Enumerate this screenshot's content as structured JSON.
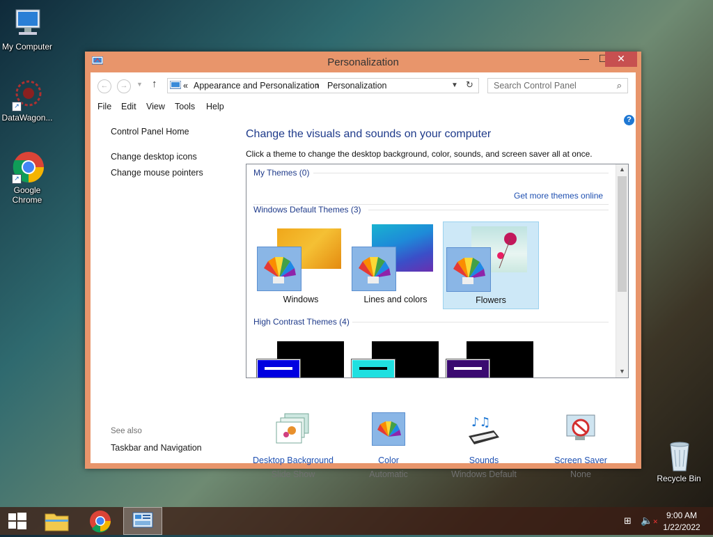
{
  "desktop": {
    "icons": [
      {
        "label": "My Computer"
      },
      {
        "label": "DataWagon..."
      },
      {
        "label": "Google Chrome"
      },
      {
        "label": "Recycle Bin"
      }
    ]
  },
  "window": {
    "title": "Personalization",
    "controls": {
      "minimize": "—",
      "maximize": "☐",
      "close": "✕"
    },
    "breadcrumb": {
      "sep_root": "«",
      "part1": "Appearance and Personalization",
      "sep": "›",
      "part2": "Personalization"
    },
    "search_placeholder": "Search Control Panel",
    "menu": [
      "File",
      "Edit",
      "View",
      "Tools",
      "Help"
    ],
    "left": {
      "home": "Control Panel Home",
      "links": [
        "Change desktop icons",
        "Change mouse pointers"
      ],
      "see_also_label": "See also",
      "see_also": [
        "Taskbar and Navigation"
      ]
    },
    "heading": "Change the visuals and sounds on your computer",
    "subheading": "Click a theme to change the desktop background, color, sounds, and screen saver all at once.",
    "groups": {
      "my_themes": "My Themes (0)",
      "get_more": "Get more themes online",
      "default_themes": "Windows Default Themes (3)",
      "high_contrast": "High Contrast Themes (4)"
    },
    "themes": [
      {
        "name": "Windows",
        "selected": false
      },
      {
        "name": "Lines and colors",
        "selected": false
      },
      {
        "name": "Flowers",
        "selected": true
      }
    ],
    "bottom": [
      {
        "label": "Desktop Background",
        "value": "Slide Show"
      },
      {
        "label": "Color",
        "value": "Automatic"
      },
      {
        "label": "Sounds",
        "value": "Windows Default"
      },
      {
        "label": "Screen Saver",
        "value": "None"
      }
    ],
    "help_icon": "?"
  },
  "taskbar": {
    "time": "9:00 AM",
    "date": "1/22/2022"
  },
  "colors": {
    "window_frame": "#e8956b",
    "link_blue": "#1e4fb0",
    "heading_blue": "#1e3a8a",
    "close_red": "#c75050",
    "selected_theme": "#cde8f7"
  }
}
